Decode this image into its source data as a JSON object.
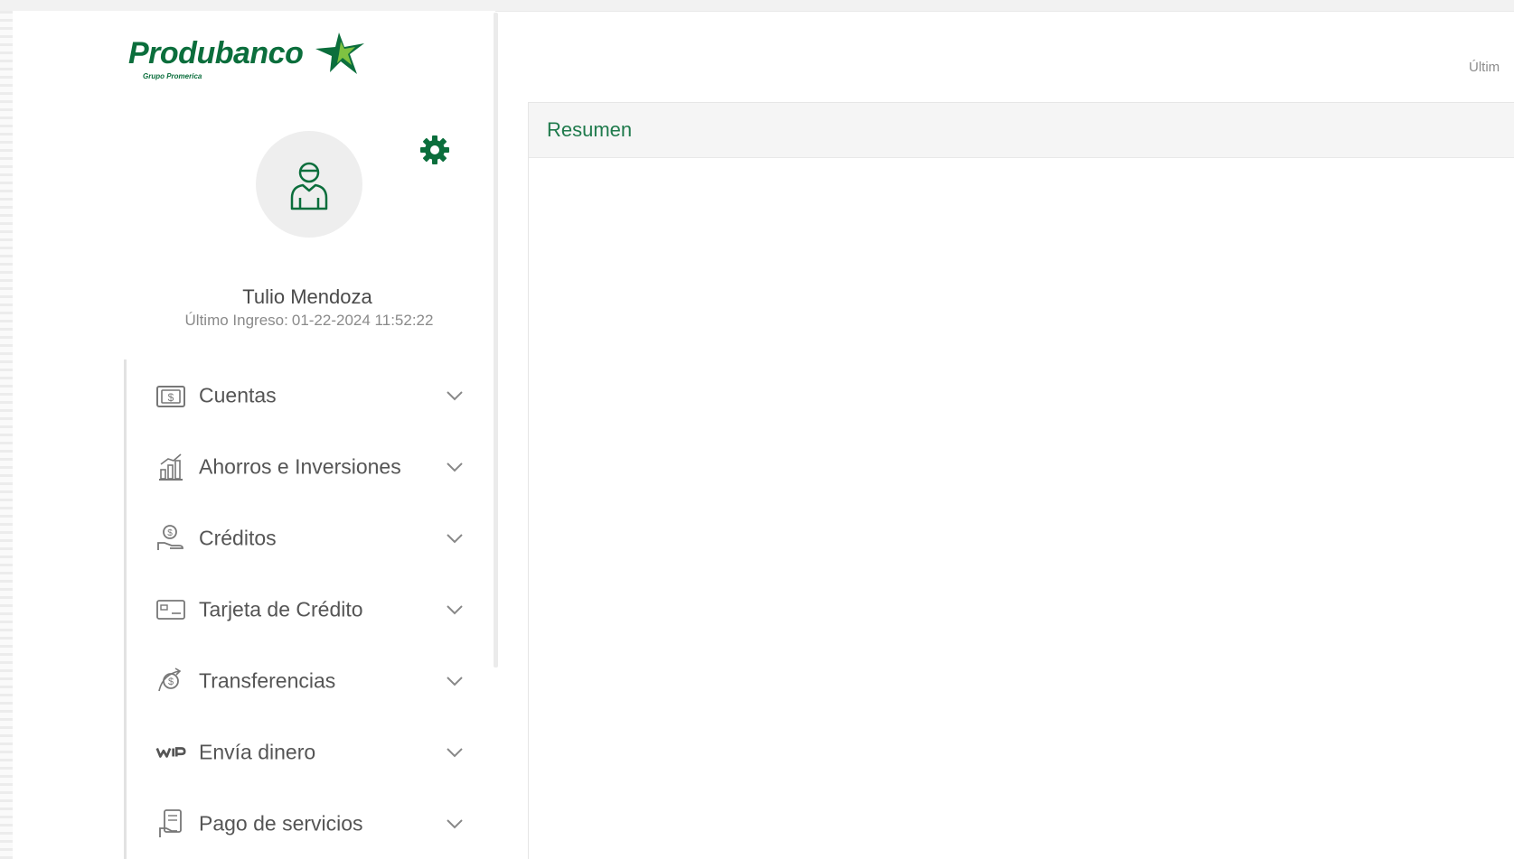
{
  "brand": {
    "name": "Produbanco",
    "subtitle": "Grupo Promerica",
    "primary_color": "#0b6e3c",
    "accent_color": "#1f7a4c"
  },
  "user": {
    "name": "Tulio Mendoza",
    "last_login_label": "Último Ingreso:",
    "last_login_value": "01-22-2024 11:52:22"
  },
  "menu": [
    {
      "label": "Cuentas",
      "icon": "cash-icon"
    },
    {
      "label": "Ahorros e Inversiones",
      "icon": "investments-chart-icon"
    },
    {
      "label": "Créditos",
      "icon": "credit-hand-icon"
    },
    {
      "label": "Tarjeta de Crédito",
      "icon": "credit-card-icon"
    },
    {
      "label": "Transferencias",
      "icon": "transfer-icon"
    },
    {
      "label": "Envía dinero",
      "icon": "wip-icon"
    },
    {
      "label": "Pago de servicios",
      "icon": "bill-icon"
    }
  ],
  "main": {
    "header_right_text": "Últim",
    "panel_title": "Resumen"
  },
  "icons": {
    "settings": "gear-icon",
    "avatar": "user-avatar-icon",
    "chevron": "chevron-down-icon"
  }
}
